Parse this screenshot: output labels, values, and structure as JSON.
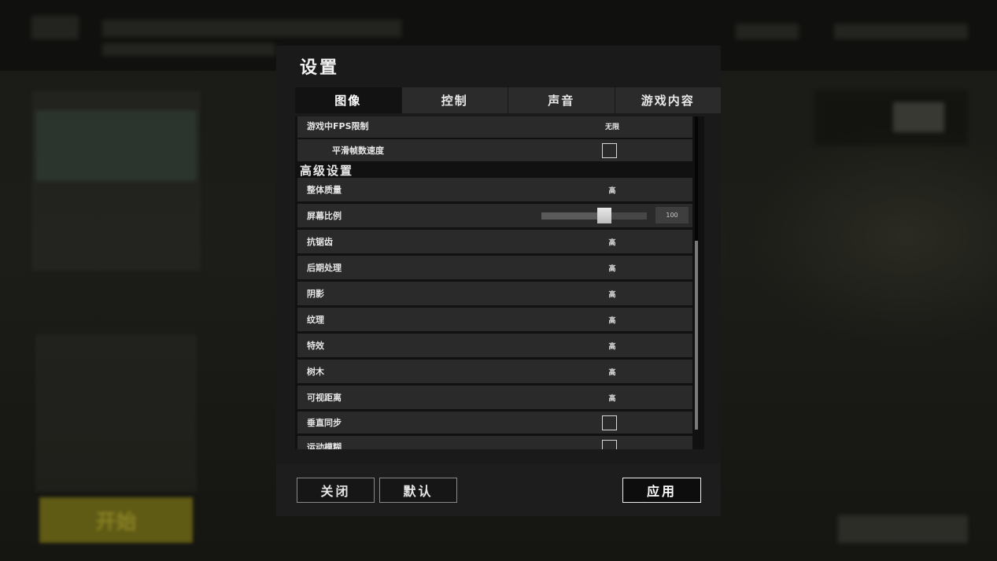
{
  "background": {
    "start_label": "开始"
  },
  "settings": {
    "title": "设置",
    "tabs": [
      {
        "label": "图像",
        "active": true
      },
      {
        "label": "控制",
        "active": false
      },
      {
        "label": "声音",
        "active": false
      },
      {
        "label": "游戏内容",
        "active": false
      }
    ],
    "rows": {
      "fps_limit": {
        "label": "游戏中FPS限制",
        "value": "无限"
      },
      "smooth_frame": {
        "label": "平滑帧数速度",
        "checked": false
      },
      "advanced_header": "高级设置",
      "overall_quality": {
        "label": "整体质量",
        "value": "高"
      },
      "screen_scale": {
        "label": "屏幕比例",
        "value": "100",
        "level": 0.6
      },
      "anti_aliasing": {
        "label": "抗锯齿",
        "value": "高"
      },
      "post_processing": {
        "label": "后期处理",
        "value": "高"
      },
      "shadows": {
        "label": "阴影",
        "value": "高"
      },
      "textures": {
        "label": "纹理",
        "value": "高"
      },
      "effects": {
        "label": "特效",
        "value": "高"
      },
      "foliage": {
        "label": "树木",
        "value": "高"
      },
      "view_distance": {
        "label": "可视距离",
        "value": "高"
      },
      "vsync": {
        "label": "垂直同步",
        "checked": false
      },
      "motion_blur": {
        "label": "运动模糊",
        "checked": false
      }
    },
    "footer": {
      "close_label": "关闭",
      "default_label": "默认",
      "apply_label": "应用"
    }
  }
}
